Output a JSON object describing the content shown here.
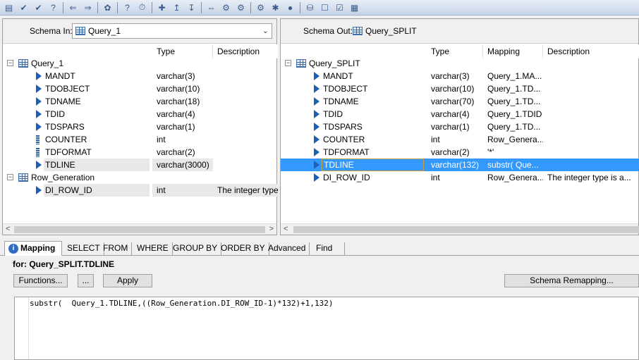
{
  "toolbar": {
    "icons": [
      "form-icon",
      "check-icon",
      "validate-icon",
      "help-icon",
      "back-icon",
      "forward-icon",
      "object-icon",
      "help-circle-icon",
      "clock-icon",
      "hierarchy-icon",
      "up-icon",
      "down-icon",
      "align-icon",
      "gear-a-icon",
      "gear-b-icon",
      "gear-c-icon",
      "stop-icon",
      "globe-icon",
      "database-icon",
      "properties-icon",
      "checkbox-icon",
      "grid-icon"
    ],
    "glyphs": [
      "▤",
      "✔",
      "✔",
      "?",
      "⇐",
      "⇒",
      "✿",
      "?",
      "⏱",
      "✚",
      "↥",
      "↧",
      "⇔",
      "⚙",
      "⚙",
      "⚙",
      "✱",
      "●",
      "⛁",
      "☐",
      "☑",
      "▦"
    ]
  },
  "schema_in": {
    "label": "Schema In:",
    "selected": "Query_1",
    "headers": [
      "Type",
      "Description"
    ],
    "tree": [
      {
        "name": "Query_1",
        "kind": "table",
        "type": "",
        "desc": ""
      },
      {
        "name": "MANDT",
        "kind": "column",
        "type": "varchar(3)",
        "desc": ""
      },
      {
        "name": "TDOBJECT",
        "kind": "column",
        "type": "varchar(10)",
        "desc": ""
      },
      {
        "name": "TDNAME",
        "kind": "column",
        "type": "varchar(18)",
        "desc": ""
      },
      {
        "name": "TDID",
        "kind": "column",
        "type": "varchar(4)",
        "desc": ""
      },
      {
        "name": "TDSPARS",
        "kind": "column",
        "type": "varchar(1)",
        "desc": ""
      },
      {
        "name": "COUNTER",
        "kind": "key",
        "type": "int",
        "desc": ""
      },
      {
        "name": "TDFORMAT",
        "kind": "key",
        "type": "varchar(2)",
        "desc": ""
      },
      {
        "name": "TDLINE",
        "kind": "column",
        "type": "varchar(3000)",
        "desc": ""
      },
      {
        "name": "Row_Generation",
        "kind": "table",
        "type": "",
        "desc": ""
      },
      {
        "name": "DI_ROW_ID",
        "kind": "column",
        "type": "int",
        "desc": "The integer type"
      }
    ]
  },
  "schema_out": {
    "label": "Schema Out:",
    "selected": "Query_SPLIT",
    "headers": [
      "Type",
      "Mapping",
      "Description"
    ],
    "tree": [
      {
        "name": "Query_SPLIT",
        "kind": "table",
        "type": "",
        "mapping": "",
        "desc": ""
      },
      {
        "name": "MANDT",
        "kind": "column",
        "type": "varchar(3)",
        "mapping": "Query_1.MA...",
        "desc": ""
      },
      {
        "name": "TDOBJECT",
        "kind": "column",
        "type": "varchar(10)",
        "mapping": "Query_1.TD...",
        "desc": ""
      },
      {
        "name": "TDNAME",
        "kind": "column",
        "type": "varchar(70)",
        "mapping": "Query_1.TD...",
        "desc": ""
      },
      {
        "name": "TDID",
        "kind": "column",
        "type": "varchar(4)",
        "mapping": "Query_1.TDID",
        "desc": ""
      },
      {
        "name": "TDSPARS",
        "kind": "column",
        "type": "varchar(1)",
        "mapping": "Query_1.TD...",
        "desc": ""
      },
      {
        "name": "COUNTER",
        "kind": "column",
        "type": "int",
        "mapping": "Row_Genera...",
        "desc": ""
      },
      {
        "name": "TDFORMAT",
        "kind": "column",
        "type": "varchar(2)",
        "mapping": "'*'",
        "desc": ""
      },
      {
        "name": "TDLINE",
        "kind": "column",
        "type": "varchar(132)",
        "mapping": "substr( Que...",
        "desc": ""
      },
      {
        "name": "DI_ROW_ID",
        "kind": "column",
        "type": "int",
        "mapping": "Row_Genera...",
        "desc": "The integer type is a..."
      }
    ]
  },
  "tabs": [
    "Mapping",
    "SELECT",
    "FROM",
    "WHERE",
    "GROUP BY",
    "ORDER BY",
    "Advanced",
    "Find"
  ],
  "mapping": {
    "for_label": "for: Query_SPLIT.TDLINE",
    "functions_button": "Functions...",
    "ellipsis_button": "...",
    "apply_button": "Apply",
    "remap_button": "Schema Remapping...",
    "expression": "substr(  Query_1.TDLINE,((Row_Generation.DI_ROW_ID-1)*132)+1,132)"
  }
}
